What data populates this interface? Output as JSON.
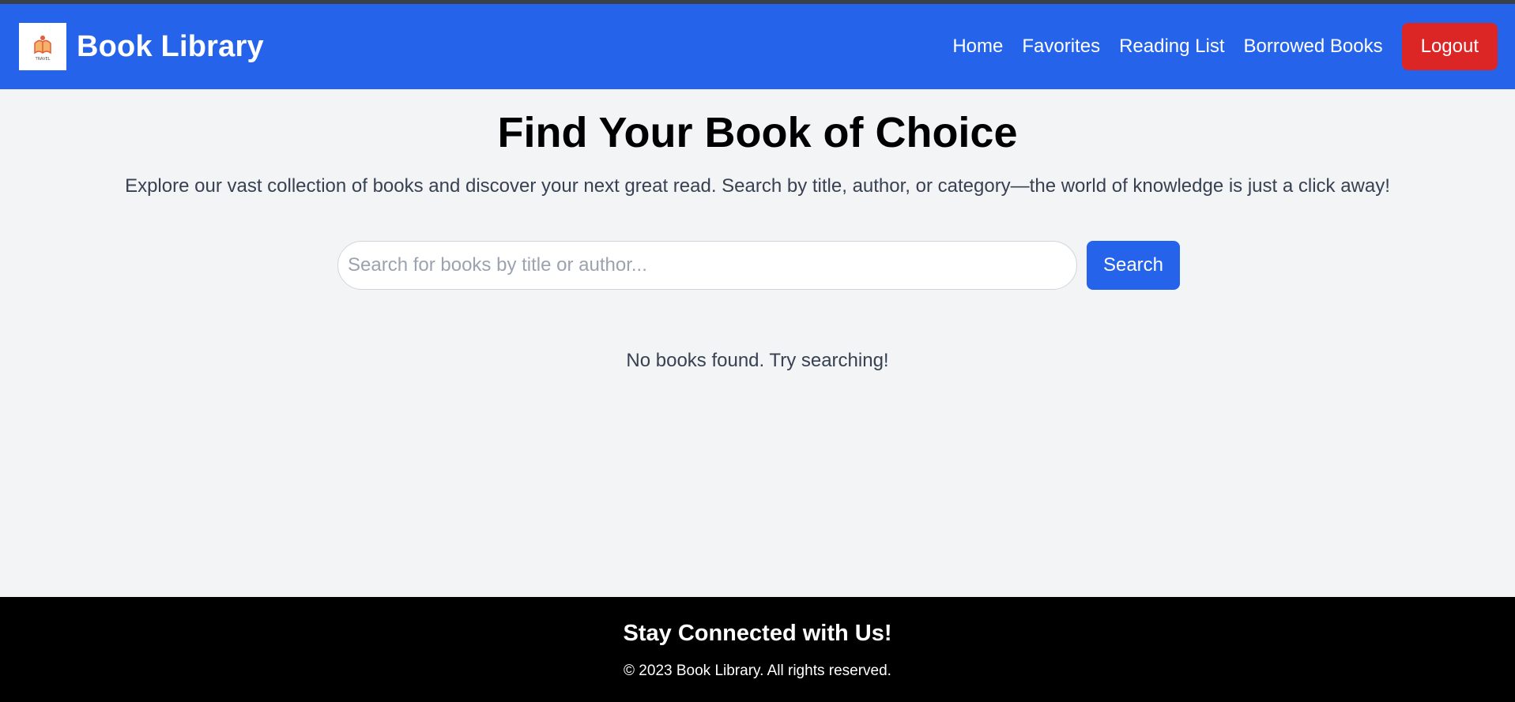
{
  "header": {
    "brand": "Book Library",
    "logo_text": "TRAVEL",
    "nav": [
      "Home",
      "Favorites",
      "Reading List",
      "Borrowed Books"
    ],
    "logout_label": "Logout"
  },
  "main": {
    "title": "Find Your Book of Choice",
    "subtitle": "Explore our vast collection of books and discover your next great read. Search by title, author, or category—the world of knowledge is just a click away!",
    "search": {
      "placeholder": "Search for books by title or author...",
      "value": "",
      "button_label": "Search"
    },
    "empty_message": "No books found. Try searching!"
  },
  "footer": {
    "title": "Stay Connected with Us!",
    "copyright": "© 2023 Book Library. All rights reserved."
  },
  "colors": {
    "primary": "#2563eb",
    "danger": "#dc2626",
    "background": "#f3f4f6",
    "footer": "#000000",
    "icon_book": "#e35d3a"
  }
}
